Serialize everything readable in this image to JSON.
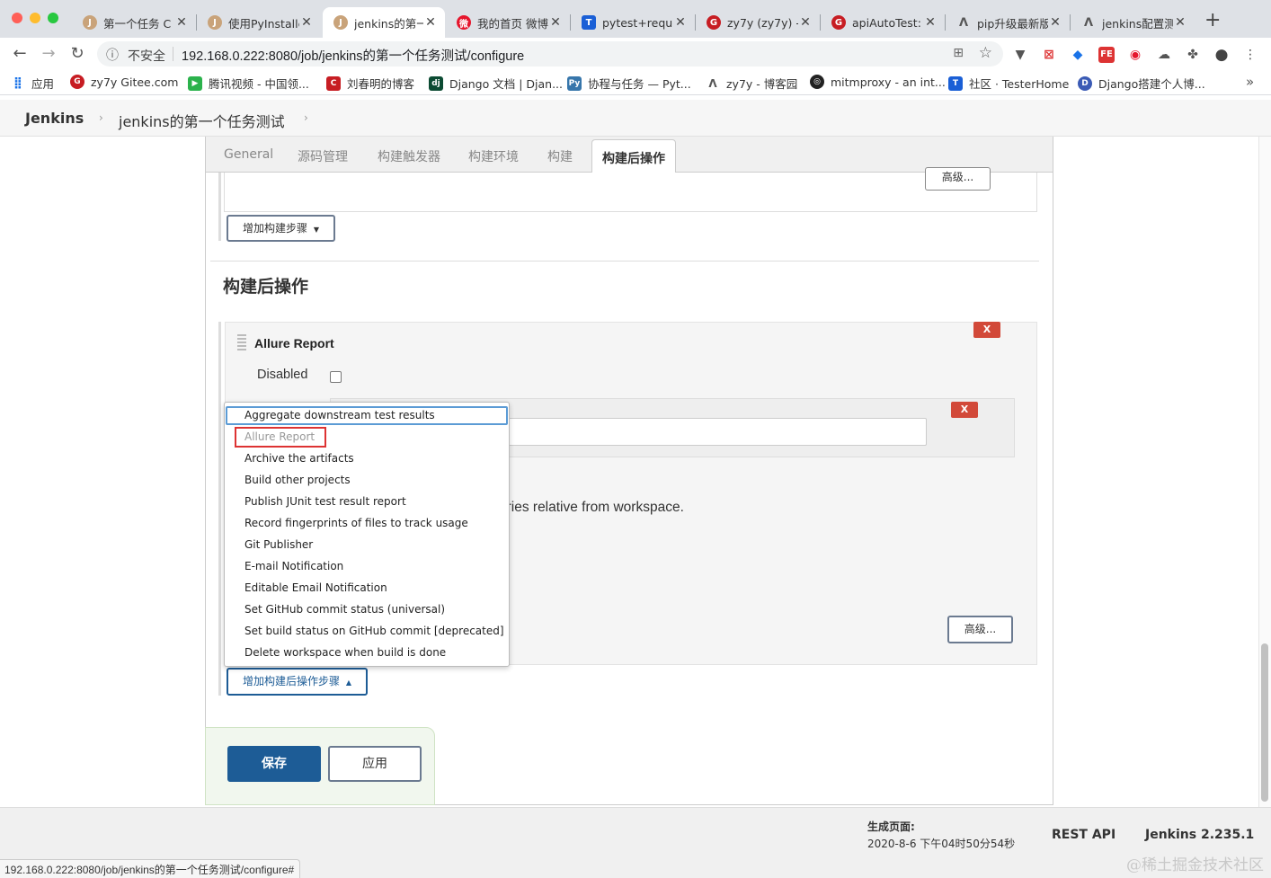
{
  "window_controls": {
    "close_color": "#ff5f57",
    "minimize_color": "#febc2e",
    "maximize_color": "#28c840"
  },
  "tabs": [
    {
      "title": "第一个任务 C",
      "icon": "jenkins-icon"
    },
    {
      "title": "使用PyInstalle",
      "icon": "jenkins-icon"
    },
    {
      "title": "jenkins的第一",
      "icon": "jenkins-icon",
      "active": true
    },
    {
      "title": "我的首页 微博",
      "icon": "weibo-icon"
    },
    {
      "title": "pytest+reque",
      "icon": "shield-icon"
    },
    {
      "title": "zy7y (zy7y) -",
      "icon": "gitee-icon"
    },
    {
      "title": "apiAutoTest:",
      "icon": "gitee-icon"
    },
    {
      "title": "pip升级最新版",
      "icon": "cnblogs-icon"
    },
    {
      "title": "jenkins配置测",
      "icon": "cnblogs-icon"
    }
  ],
  "tab_close_glyph": "✕",
  "new_tab_glyph": "+",
  "address": {
    "insecure_label": "不安全",
    "url": "192.168.0.222:8080/job/jenkins的第一个任务测试/configure"
  },
  "bookmarks": [
    {
      "label": "应用",
      "icon": "apps-grid-icon"
    },
    {
      "label": "zy7y Gitee.com",
      "icon": "gitee-icon"
    },
    {
      "label": "腾讯视频 - 中国领...",
      "icon": "tencent-video-icon"
    },
    {
      "label": "刘春明的博客",
      "icon": "csdn-icon"
    },
    {
      "label": "Django 文档 | Djan...",
      "icon": "django-icon"
    },
    {
      "label": "协程与任务 — Pyt...",
      "icon": "python-icon"
    },
    {
      "label": "zy7y - 博客园",
      "icon": "cnblogs-icon"
    },
    {
      "label": "mitmproxy - an int...",
      "icon": "mitmproxy-icon"
    },
    {
      "label": "社区 · TesterHome",
      "icon": "testerhome-icon"
    },
    {
      "label": "Django搭建个人博...",
      "icon": "blog-icon"
    }
  ],
  "bookmarks_more": "»",
  "breadcrumb": {
    "root": "Jenkins",
    "job": "jenkins的第一个任务测试"
  },
  "config_tabs": [
    "General",
    "源码管理",
    "构建触发器",
    "构建环境",
    "构建",
    "构建后操作"
  ],
  "active_config_tab": "构建后操作",
  "build_section": {
    "advanced_label": "高级...",
    "add_step_label": "增加构建步骤"
  },
  "post_build": {
    "section_title": "构建后操作",
    "allure_title": "Allure Report",
    "disabled_label": "Disabled",
    "delete_label": "X",
    "relative_hint_suffix": "ories relative from workspace.",
    "advanced_label": "高级...",
    "add_post_step_label": "增加构建后操作步骤"
  },
  "dropdown_items": [
    "Aggregate downstream test results",
    "Allure Report",
    "Archive the artifacts",
    "Build other projects",
    "Publish JUnit test result report",
    "Record fingerprints of files to track usage",
    "Git Publisher",
    "E-mail Notification",
    "Editable Email Notification",
    "Set GitHub commit status (universal)",
    "Set build status on GitHub commit [deprecated]",
    "Delete workspace when build is done"
  ],
  "actions": {
    "save_label": "保存",
    "apply_label": "应用"
  },
  "footer": {
    "generated_label": "生成页面:",
    "generated_time": "2020-8-6 下午04时50分54秒",
    "rest_api": "REST API",
    "version": "Jenkins 2.235.1"
  },
  "status_url": "192.168.0.222:8080/job/jenkins的第一个任务测试/configure#",
  "watermark": "@稀土掘金技术社区",
  "colors": {
    "primary_button": "#1d5c96",
    "delete_red": "#d24939",
    "highlight_red": "#d33",
    "focus_blue": "#5b9bd5"
  }
}
